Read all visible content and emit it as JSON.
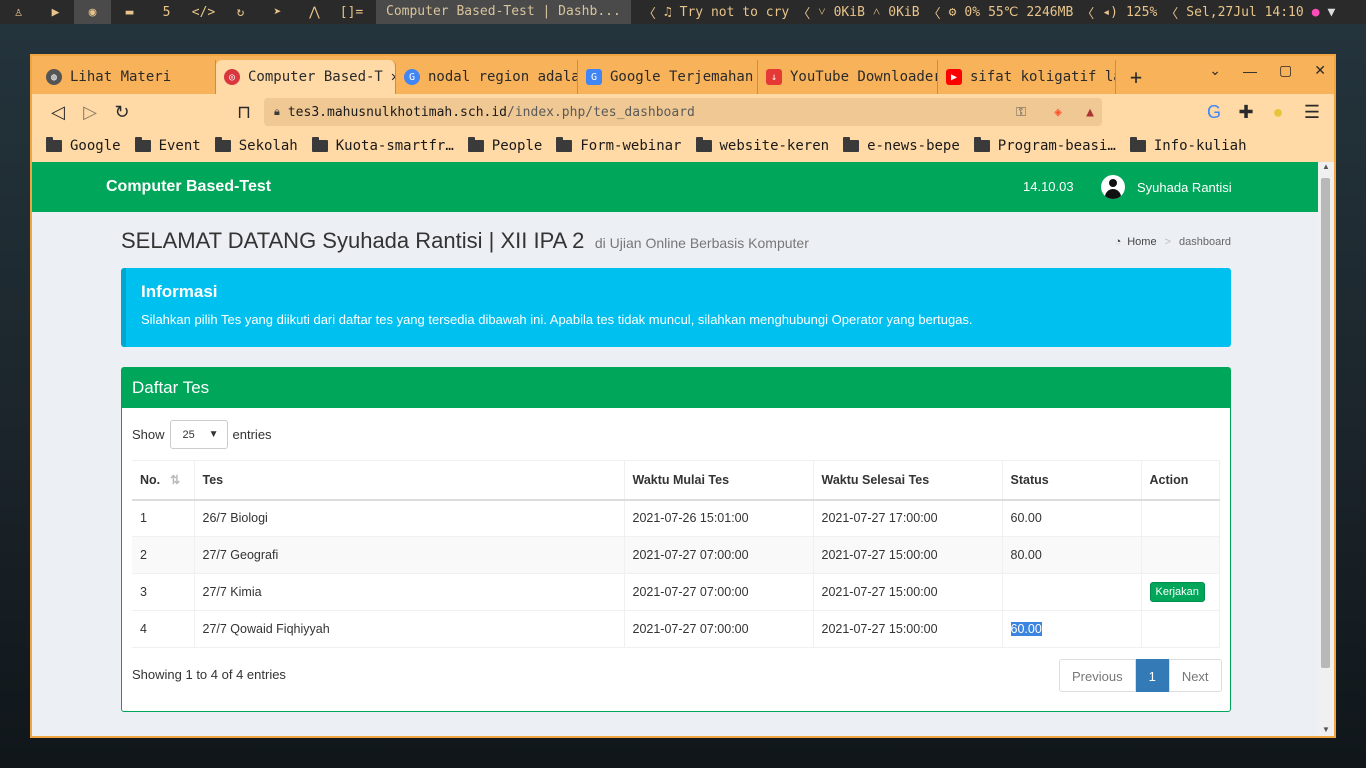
{
  "system_bar": {
    "workspace_count": "5",
    "layout_indicator": "[]=",
    "window_title": "Computer Based-Test | Dashb...",
    "now_playing": "Try not to cry",
    "net_down": "0KiB",
    "net_up": "0KiB",
    "cpu": "0%",
    "temp": "55℃",
    "mem": "2246MB",
    "volume": "125%",
    "datetime": "Sel,27Jul 14:10"
  },
  "browser": {
    "tabs": [
      {
        "label": "Lihat Materi",
        "icon_color": "#555555"
      },
      {
        "label": "Computer Based-T",
        "icon_color": "#d9363e"
      },
      {
        "label": "nodal region adala",
        "icon_color": "#4285f4"
      },
      {
        "label": "Google Terjemahan",
        "icon_color": "#4285f4"
      },
      {
        "label": "YouTube Downloader",
        "icon_color": "#e53935"
      },
      {
        "label": "sifat koligatif la",
        "icon_color": "#ff0000"
      }
    ],
    "url_host": "tes3.mahusnulkhotimah.sch.id",
    "url_path": "/index.php/tes_dashboard",
    "bookmarks": [
      "Google",
      "Event",
      "Sekolah",
      "Kuota-smartfr…",
      "People",
      "Form-webinar",
      "website-keren",
      "e-news-bepe",
      "Program-beasi…",
      "Info-kuliah"
    ]
  },
  "app": {
    "brand": "Computer Based-Test",
    "clock": "14.10.03",
    "user_name": "Syuhada Rantisi"
  },
  "page": {
    "title": "SELAMAT DATANG Syuhada Rantisi | XII IPA 2",
    "subtitle": "di Ujian Online Berbasis Komputer",
    "breadcrumb_home": "Home",
    "breadcrumb_current": "dashboard"
  },
  "callout": {
    "title": "Informasi",
    "text": "Silahkan pilih Tes yang diikuti dari daftar tes yang tersedia dibawah ini. Apabila tes tidak muncul, silahkan menghubungi Operator yang bertugas."
  },
  "box": {
    "title": "Daftar Tes",
    "show_label": "Show",
    "entries_label": "entries",
    "page_length": "25",
    "columns": [
      "No.",
      "Tes",
      "Waktu Mulai Tes",
      "Waktu Selesai Tes",
      "Status",
      "Action"
    ],
    "rows": [
      {
        "no": "1",
        "tes": "26/7 Biologi",
        "mulai": "2021-07-26 15:01:00",
        "selesai": "2021-07-27 17:00:00",
        "status": "60.00",
        "action": ""
      },
      {
        "no": "2",
        "tes": "27/7 Geografi",
        "mulai": "2021-07-27 07:00:00",
        "selesai": "2021-07-27 15:00:00",
        "status": "80.00",
        "action": ""
      },
      {
        "no": "3",
        "tes": "27/7 Kimia",
        "mulai": "2021-07-27 07:00:00",
        "selesai": "2021-07-27 15:00:00",
        "status": "",
        "action": "Kerjakan"
      },
      {
        "no": "4",
        "tes": "27/7 Qowaid Fiqhiyyah",
        "mulai": "2021-07-27 07:00:00",
        "selesai": "2021-07-27 15:00:00",
        "status": "60.00",
        "action": ""
      }
    ],
    "info": "Showing 1 to 4 of 4 entries",
    "pagination": {
      "previous": "Previous",
      "current": "1",
      "next": "Next"
    }
  }
}
